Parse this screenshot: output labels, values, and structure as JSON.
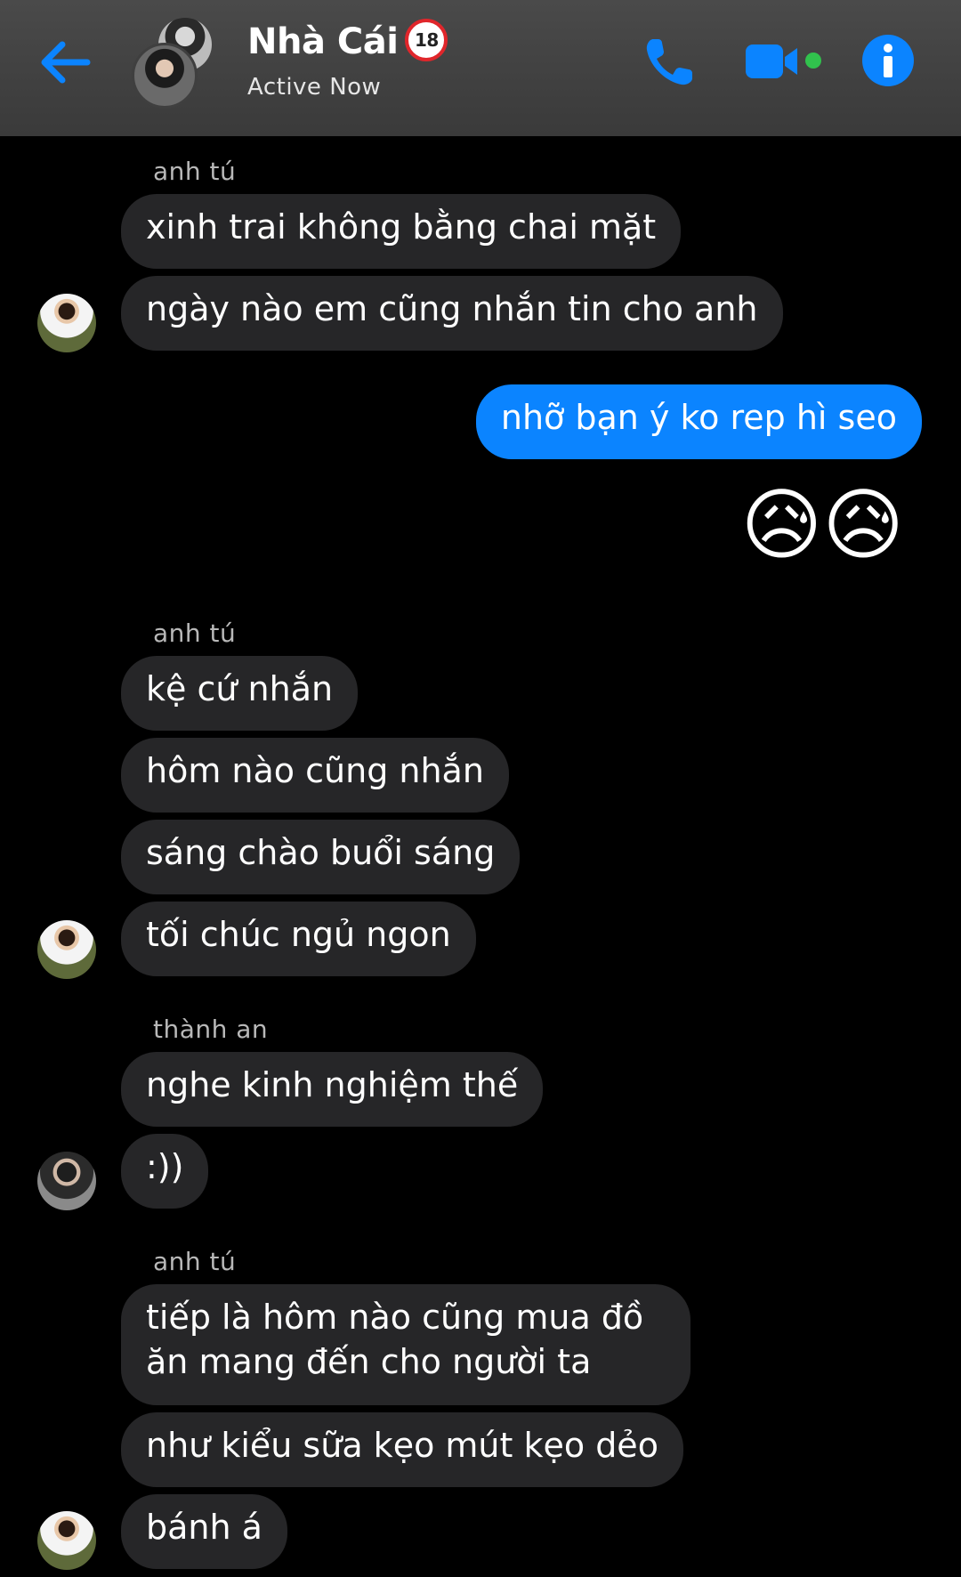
{
  "header": {
    "title": "Nhà Cái",
    "badge": "18",
    "status": "Active Now",
    "accent_color": "#0b84ff",
    "icons": [
      "back-arrow-icon",
      "phone-icon",
      "video-camera-icon",
      "info-icon"
    ]
  },
  "messages": [
    {
      "sender": "anh tú",
      "texts": [
        "xinh trai không bằng chai mặt",
        "ngày nào em cũng nhắn tin cho anh"
      ]
    },
    {
      "sent": "nhỡ bạn ý ko rep hì seo",
      "emoji": "😥😥"
    },
    {
      "sender": "anh tú",
      "texts": [
        "kệ cứ nhắn",
        "hôm nào cũng nhắn",
        "sáng chào buổi sáng",
        "tối chúc ngủ ngon"
      ]
    },
    {
      "sender": "thành an",
      "texts": [
        "nghe kinh nghiệm thế",
        ":))"
      ]
    },
    {
      "sender": "anh tú",
      "texts": [
        "tiếp là hôm nào cũng mua đồ ăn mang đến cho người ta",
        "như kiểu sữa kẹo mút kẹo dẻo",
        "bánh á"
      ]
    }
  ]
}
